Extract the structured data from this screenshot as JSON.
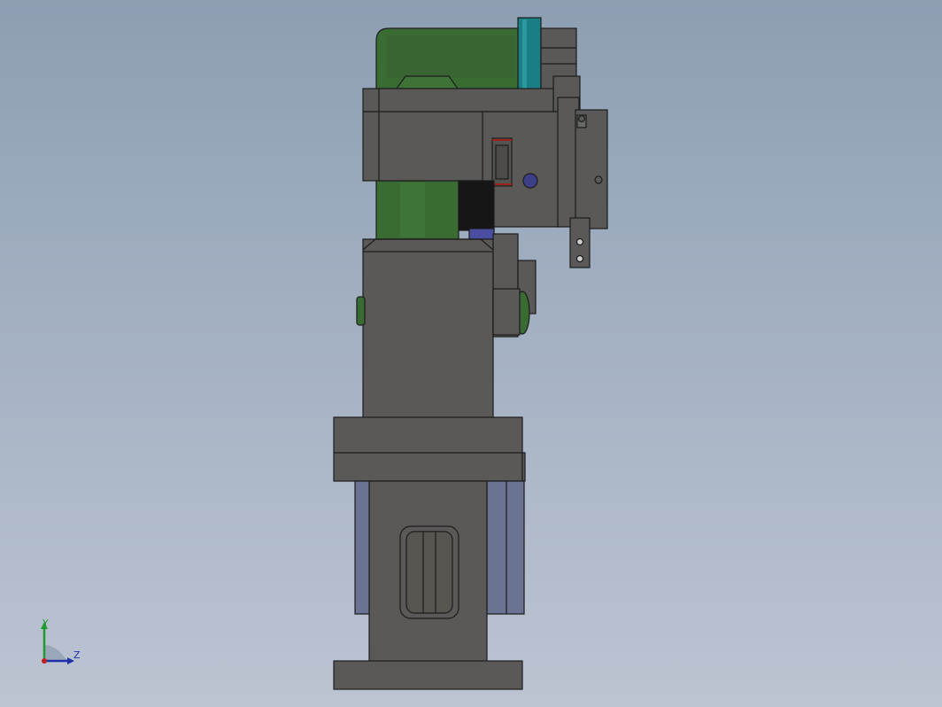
{
  "viewport": {
    "background_top": "#8d9eb3",
    "background_bottom": "#bcc4d2"
  },
  "part_colors": {
    "body_gray": "#5b5957",
    "outline": "#1c1c1c",
    "green_link": "#3a6b33",
    "teal_pulley": "#1a7f85",
    "slot_blue": "#6a7391",
    "dark_block": "#161616",
    "purple_pin": "#4a4ea0"
  },
  "triad": {
    "y_label": "Y",
    "z_label": "Z",
    "y_color": "#1f9a2f",
    "z_color": "#1e2fa8",
    "origin_color": "#c21e1e"
  }
}
